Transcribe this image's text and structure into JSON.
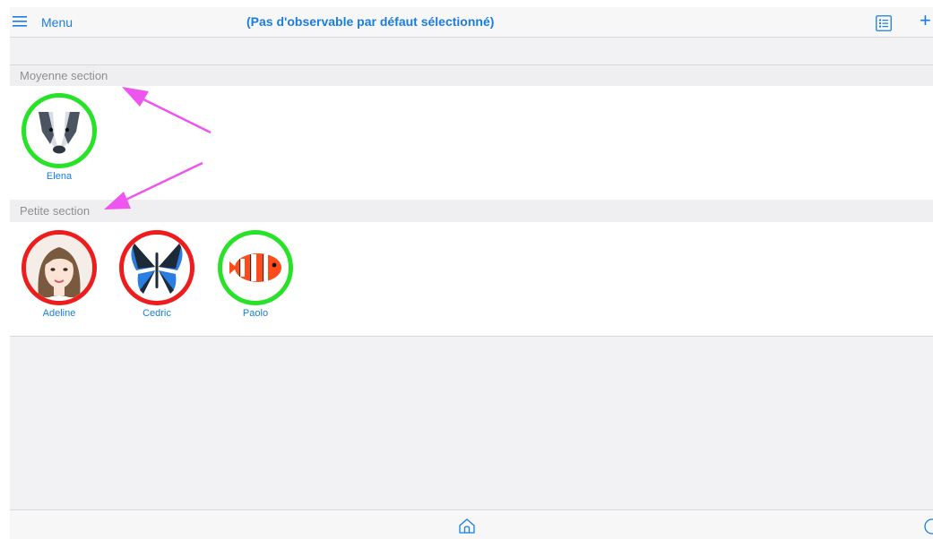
{
  "header": {
    "menu_label": "Menu",
    "title": "(Pas d'observable par défaut sélectionné)",
    "icons": [
      "menu-icon",
      "list-view-icon",
      "add-icon"
    ]
  },
  "groups": [
    {
      "label": "Moyenne section",
      "students": [
        {
          "name": "Elena",
          "avatar": "badger",
          "status": "green"
        }
      ]
    },
    {
      "label": "Petite section",
      "students": [
        {
          "name": "Adeline",
          "avatar": "girl-portrait",
          "status": "red"
        },
        {
          "name": "Cedric",
          "avatar": "butterfly",
          "status": "red"
        },
        {
          "name": "Paolo",
          "avatar": "clownfish",
          "status": "green"
        }
      ]
    }
  ],
  "footer": {
    "icons": [
      "home-icon",
      "help-icon"
    ]
  },
  "colors": {
    "accent": "#1a7ee0",
    "status_green": "#27e227",
    "status_red": "#ee1c1c",
    "annotation_arrow": "#ee55ee"
  }
}
